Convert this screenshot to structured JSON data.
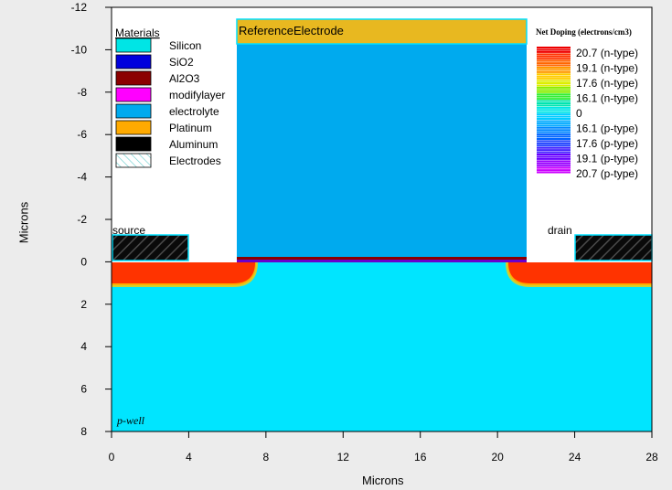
{
  "axes": {
    "x_label": "Microns",
    "y_label": "Microns",
    "x_ticks": [
      "0",
      "4",
      "8",
      "12",
      "16",
      "20",
      "24",
      "28"
    ],
    "y_ticks": [
      "-12",
      "-10",
      "-8",
      "-6",
      "-4",
      "-2",
      "0",
      "2",
      "4",
      "6",
      "8"
    ]
  },
  "materials_legend": {
    "title": "Materials",
    "items": [
      {
        "label": "Silicon",
        "color": "#00e5e5"
      },
      {
        "label": "SiO2",
        "color": "#0000dd"
      },
      {
        "label": "Al2O3",
        "color": "#8b0000"
      },
      {
        "label": "modifylayer",
        "color": "#ff00ff"
      },
      {
        "label": "electrolyte",
        "color": "#00aaee"
      },
      {
        "label": "Platinum",
        "color": "#ffaa00"
      },
      {
        "label": "Aluminum",
        "color": "#000000"
      },
      {
        "label": "Electrodes",
        "color": "hatch-cyan"
      }
    ]
  },
  "doping_legend": {
    "title": "Net Doping (electrons/cm3)",
    "items": [
      {
        "label": "20.7 (n-type)",
        "color": "#ee0000"
      },
      {
        "label": "19.1 (n-type)",
        "color": "#ff6600"
      },
      {
        "label": "17.6 (n-type)",
        "color": "#ffcc00"
      },
      {
        "label": "16.1 (n-type)",
        "color": "#88ee00"
      },
      {
        "label": "0",
        "color": "#00e5e5"
      },
      {
        "label": "16.1 (p-type)",
        "color": "#00aaff"
      },
      {
        "label": "17.6 (p-type)",
        "color": "#0066ff"
      },
      {
        "label": "19.1 (p-type)",
        "color": "#6600ff"
      },
      {
        "label": "20.7 (p-type)",
        "color": "#cc00ff"
      }
    ]
  },
  "region_labels": {
    "reference_electrode": "ReferenceElectrode",
    "source": "source",
    "drain": "drain",
    "substrate": "p-well"
  },
  "colors": {
    "silicon": "#00e5ff",
    "electrolyte": "#00aaee",
    "electrode": "#e8b820",
    "n_region": "#ff3300",
    "electrode_outline": "#00e0ff"
  }
}
